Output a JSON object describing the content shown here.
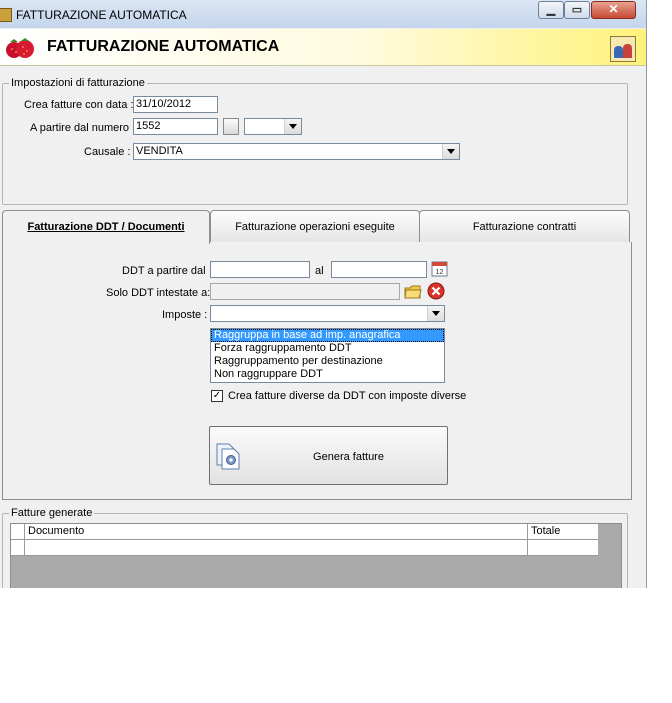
{
  "window": {
    "title": "FATTURAZIONE AUTOMATICA",
    "min_glyph": "▁",
    "max_glyph": "▭",
    "close_glyph": "✕"
  },
  "header": {
    "title": "FATTURAZIONE AUTOMATICA"
  },
  "settings": {
    "legend": "Impostazioni di fatturazione",
    "date_label": "Crea fatture con data :",
    "date_value": "31/10/2012",
    "number_label": "A partire dal numero :",
    "number_value": "1552",
    "suffix_value": "",
    "causale_label": "Causale :",
    "causale_value": "VENDITA"
  },
  "tabs": [
    {
      "label": "Fatturazione DDT / Documenti",
      "active": true
    },
    {
      "label": "Fatturazione operazioni eseguite",
      "active": false
    },
    {
      "label": "Fatturazione contratti",
      "active": false
    }
  ],
  "ddt": {
    "from_label": "DDT a partire dal",
    "to_label": "al",
    "from_value": "",
    "to_value": "",
    "only_label": "Solo DDT intestate a:",
    "only_value": "",
    "imposte_label": "Imposte :",
    "imposte_value": "",
    "grouping_options": [
      "Raggruppa in base ad imp. anagrafica",
      "Forza raggruppamento DDT",
      "Raggruppamento per destinazione",
      "Non raggruppare DDT"
    ],
    "grouping_selected_index": 0,
    "checkbox_label": "Crea fatture diverse da DDT con imposte diverse",
    "checkbox_checked": true,
    "checkbox_mark": "✓",
    "generate_label": "Genera fatture"
  },
  "generated": {
    "legend": "Fatture generate",
    "columns": [
      "Documento",
      "Totale"
    ],
    "rows": [
      [
        "",
        ""
      ]
    ]
  },
  "icons": {
    "calendar": "calendar-icon",
    "folder": "folder-icon",
    "clear": "clear-icon",
    "generate": "document-gear-icon",
    "users": "users-icon",
    "logo": "strawberry-logo"
  }
}
